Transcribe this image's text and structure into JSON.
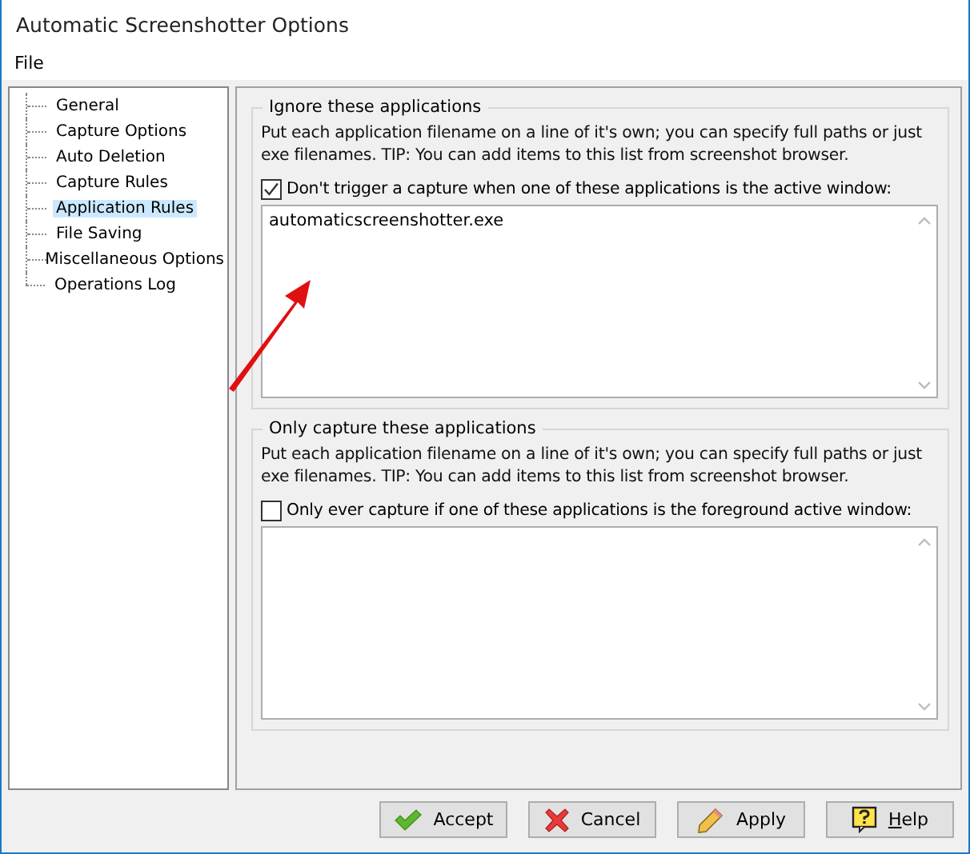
{
  "window": {
    "title": "Automatic Screenshotter Options"
  },
  "menu": [
    "File"
  ],
  "sidebar": {
    "items": [
      {
        "label": "General",
        "selected": false
      },
      {
        "label": "Capture Options",
        "selected": false
      },
      {
        "label": "Auto Deletion",
        "selected": false
      },
      {
        "label": "Capture Rules",
        "selected": false
      },
      {
        "label": "Application Rules",
        "selected": true
      },
      {
        "label": "File Saving",
        "selected": false
      },
      {
        "label": "Miscellaneous Options",
        "selected": false
      },
      {
        "label": "Operations Log",
        "selected": false
      }
    ]
  },
  "groups": [
    {
      "title": "Ignore these applications",
      "description": "Put each application filename on a line of it's own; you can specify full paths or just exe filenames. TIP: You can add items to this list from screenshot browser.",
      "checkbox": {
        "label": "Don't trigger a capture when one of these applications is the active window:",
        "checked": true
      },
      "value": "automaticscreenshotter.exe"
    },
    {
      "title": "Only capture these applications",
      "description": "Put each application filename on a line of it's own; you can specify full paths or just exe filenames. TIP: You can add items to this list from screenshot browser.",
      "checkbox": {
        "label": "Only ever capture if one of these applications is the foreground active window:",
        "checked": false
      }
    }
  ],
  "annotation": {
    "kind": "arrow"
  },
  "buttons": [
    {
      "label": "Accept",
      "kind": "accept"
    },
    {
      "label": "Cancel",
      "kind": "cancel"
    },
    {
      "label": "Apply",
      "kind": "apply"
    },
    {
      "label": "Help",
      "kind": "help",
      "underline_first": true
    }
  ]
}
